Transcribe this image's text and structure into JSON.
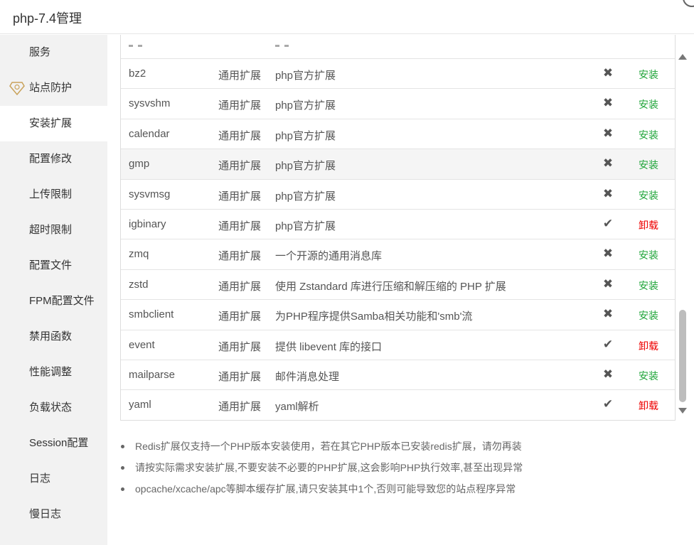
{
  "window": {
    "title": "php-7.4管理"
  },
  "sidebar": {
    "items": [
      {
        "label": "服务",
        "active": false
      },
      {
        "label": "站点防护",
        "active": false,
        "icon": "diamond-icon"
      },
      {
        "label": "安装扩展",
        "active": true
      },
      {
        "label": "配置修改",
        "active": false
      },
      {
        "label": "上传限制",
        "active": false
      },
      {
        "label": "超时限制",
        "active": false
      },
      {
        "label": "配置文件",
        "active": false
      },
      {
        "label": "FPM配置文件",
        "active": false
      },
      {
        "label": "禁用函数",
        "active": false
      },
      {
        "label": "性能调整",
        "active": false
      },
      {
        "label": "负载状态",
        "active": false
      },
      {
        "label": "Session配置",
        "active": false
      },
      {
        "label": "日志",
        "active": false
      },
      {
        "label": "慢日志",
        "active": false
      }
    ]
  },
  "extensions": {
    "rows": [
      {
        "name": "bz2",
        "type": "通用扩展",
        "desc": "php官方扩展",
        "status": "✖",
        "action": "安装",
        "installed": false
      },
      {
        "name": "sysvshm",
        "type": "通用扩展",
        "desc": "php官方扩展",
        "status": "✖",
        "action": "安装",
        "installed": false
      },
      {
        "name": "calendar",
        "type": "通用扩展",
        "desc": "php官方扩展",
        "status": "✖",
        "action": "安装",
        "installed": false
      },
      {
        "name": "gmp",
        "type": "通用扩展",
        "desc": "php官方扩展",
        "status": "✖",
        "action": "安装",
        "installed": false,
        "highlight": true
      },
      {
        "name": "sysvmsg",
        "type": "通用扩展",
        "desc": "php官方扩展",
        "status": "✖",
        "action": "安装",
        "installed": false
      },
      {
        "name": "igbinary",
        "type": "通用扩展",
        "desc": "php官方扩展",
        "status": "✔",
        "action": "卸载",
        "installed": true
      },
      {
        "name": "zmq",
        "type": "通用扩展",
        "desc": "一个开源的通用消息库",
        "status": "✖",
        "action": "安装",
        "installed": false
      },
      {
        "name": "zstd",
        "type": "通用扩展",
        "desc": "使用 Zstandard 库进行压缩和解压缩的 PHP 扩展",
        "status": "✖",
        "action": "安装",
        "installed": false
      },
      {
        "name": "smbclient",
        "type": "通用扩展",
        "desc": "为PHP程序提供Samba相关功能和'smb'流",
        "status": "✖",
        "action": "安装",
        "installed": false
      },
      {
        "name": "event",
        "type": "通用扩展",
        "desc": "提供 libevent 库的接口",
        "status": "✔",
        "action": "卸载",
        "installed": true
      },
      {
        "name": "mailparse",
        "type": "通用扩展",
        "desc": "邮件消息处理",
        "status": "✖",
        "action": "安装",
        "installed": false
      },
      {
        "name": "yaml",
        "type": "通用扩展",
        "desc": "yaml解析",
        "status": "✔",
        "action": "卸载",
        "installed": true
      }
    ]
  },
  "notes": [
    "Redis扩展仅支持一个PHP版本安装使用，若在其它PHP版本已安装redis扩展，请勿再装",
    "请按实际需求安装扩展,不要安装不必要的PHP扩展,这会影响PHP执行效率,甚至出现异常",
    "opcache/xcache/apc等脚本缓存扩展,请只安装其中1个,否则可能导致您的站点程序异常"
  ],
  "colors": {
    "install": "#20a53a",
    "uninstall": "#ee0000",
    "sidebar_bg": "#f2f2f2"
  }
}
